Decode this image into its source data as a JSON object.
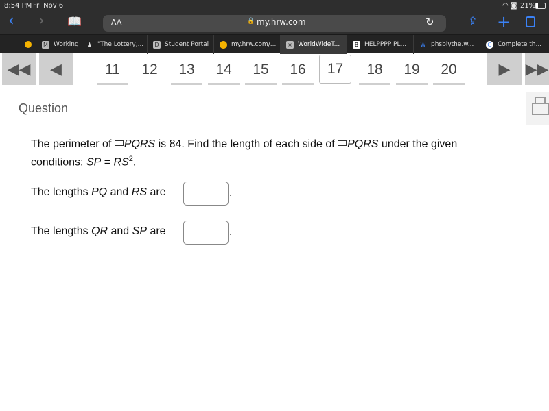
{
  "status": {
    "time": "8:54 PM",
    "date": "Fri Nov 6",
    "battery": "21%"
  },
  "browser": {
    "text_size": "AA",
    "url": "my.hrw.com"
  },
  "tabs": [
    {
      "label": "Working",
      "icon": "M"
    },
    {
      "label": "\"The Lottery,...",
      "icon": "figure"
    },
    {
      "label": "Student Portal",
      "icon": "D"
    },
    {
      "label": "my.hrw.com/...",
      "icon": "orange-dot"
    },
    {
      "label": "WorldWideT...",
      "icon": "x",
      "active": true
    },
    {
      "label": "HELPPPP PL...",
      "icon": "B"
    },
    {
      "label": "phsblythe.w...",
      "icon": "W"
    },
    {
      "label": "Complete th...",
      "icon": "G"
    }
  ],
  "pagination": {
    "pages": [
      "11",
      "12",
      "13",
      "14",
      "15",
      "16",
      "17",
      "18",
      "19",
      "20"
    ],
    "current": "17"
  },
  "question": {
    "heading": "Question",
    "line1a": "The perimeter of ",
    "shape": "PQRS",
    "line1b": " is 84. Find the length of each side of ",
    "line1c": " under the given",
    "line2a": "conditions: ",
    "sp": "SP",
    "eq": " = ",
    "rs": "RS",
    "sup": "2",
    "period": ".",
    "q1a": "The lengths ",
    "q1b": "PQ",
    "q1c": " and ",
    "q1d": "RS",
    "q1e": " are",
    "q2a": "The lengths ",
    "q2b": "QR",
    "q2c": " and ",
    "q2d": "SP",
    "q2e": " are",
    "answer1": "",
    "answer2": ""
  },
  "colors": {
    "accent": "#3b82f6",
    "nav_button": "#cfcfcf"
  }
}
